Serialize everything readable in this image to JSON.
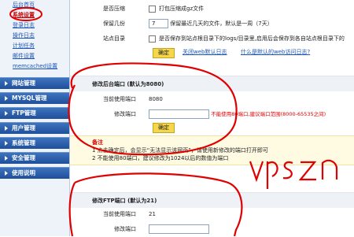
{
  "sidebar": {
    "sublinks": [
      "后台首页",
      "系统设置",
      "登录日志",
      "操作日志",
      "计划任务",
      "邮件设置",
      "memcached设置"
    ],
    "categories": [
      "网站管理",
      "MYSQL管理",
      "FTP管理",
      "用户管理",
      "系统管理",
      "安全管理",
      "使用说明"
    ]
  },
  "settings": {
    "compress_label": "是否压缩",
    "compress_text": "打包压缩成gz文件",
    "keep_label": "保留几份",
    "keep_value": "7",
    "keep_text": "保留最近几天的文件，默认是一周（7天）",
    "site_dir_label": "站点目录",
    "site_dir_text": "是否保存到站点根目录下的logs/目录里,启用后会保存到各自站点根目录下的",
    "confirm": "确定",
    "close_log_link": "关闭web默认日志",
    "what_is_link": "什么是默认的web访问日志?"
  },
  "backend_port": {
    "title": "修改后台端口 (默认为8080)",
    "current_label": "当前使用端口",
    "current_value": "8080",
    "modify_label": "修改端口",
    "warning": "不能使用80端口,建议端口范围(8000-65535之间)",
    "confirm": "确定"
  },
  "note": {
    "title": "备注",
    "line1": "1 点击确定后，会显示“无法显示该网页”，请使用新修改的端口打开即可",
    "line2": "2 不能使用80端口，建议修改为1024以后的数值为端口"
  },
  "ftp_port": {
    "title": "修改FTP端口 (默认为21)",
    "current_label": "当前使用端口",
    "current_value": "21",
    "modify_label": "修改端口"
  },
  "colors": {
    "sidebar_blue": "#1f4f9b",
    "warning_red": "#e00000",
    "button_yellow": "#f5d74c"
  }
}
